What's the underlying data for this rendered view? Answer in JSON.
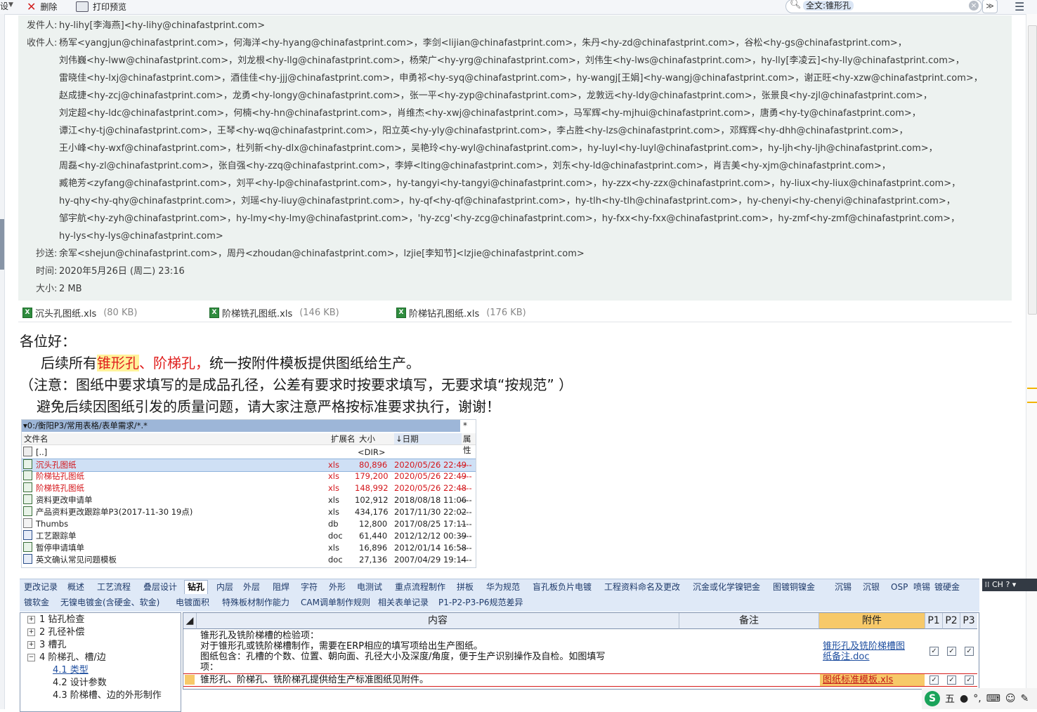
{
  "toolbar": {
    "left_fragment": "设",
    "delete_label": "删除",
    "print_label": "打印预览",
    "search_value": "全文:锥形孔"
  },
  "header": {
    "from_label": "发件人:",
    "from_value": "hy-lihy[李海燕]<hy-lihy@chinafastprint.com>",
    "to_label": "收件人:",
    "to_lines": [
      "杨军<yangjun@chinafastprint.com>，何海洋<hy-hyang@chinafastprint.com>，李剑<lijian@chinafastprint.com>，朱丹<hy-zd@chinafastprint.com>，谷松<hy-gs@chinafastprint.com>，",
      "刘伟巍<hy-lww@chinafastprint.com>，刘龙根<hy-llg@chinafastprint.com>，杨荣广<hy-yrg@chinafastprint.com>，刘伟生<hy-lws@chinafastprint.com>，hy-lly[李凌云]<hy-lly@chinafastprint.com>，",
      "雷晓佳<hy-lxj@chinafastprint.com>，酒佳佳<hy-jjj@chinafastprint.com>，申勇祁<hy-syq@chinafastprint.com>，hy-wangj[王娟]<hy-wangj@chinafastprint.com>，谢正旺<hy-xzw@chinafastprint.com>，",
      "赵成捷<hy-zcj@chinafastprint.com>，龙勇<hy-longy@chinafastprint.com>，张一平<hy-zyp@chinafastprint.com>，龙敦远<hy-ldy@chinafastprint.com>，张景良<hy-zjl@chinafastprint.com>，",
      "刘定超<hy-ldc@chinafastprint.com>，何楠<hy-hn@chinafastprint.com>，肖维杰<hy-xwj@chinafastprint.com>，马军辉<hy-mjhui@chinafastprint.com>，唐勇<hy-ty@chinafastprint.com>，",
      "谭江<hy-tj@chinafastprint.com>，王琴<hy-wq@chinafastprint.com>，阳立英<hy-yly@chinafastprint.com>，李占胜<hy-lzs@chinafastprint.com>，邓辉辉<hy-dhh@chinafastprint.com>，",
      "王小峰<hy-wxf@chinafastprint.com>，杜列新<hy-dlx@chinafastprint.com>，吴艳玲<hy-wyl@chinafastprint.com>，hy-luyl<hy-luyl@chinafastprint.com>，hy-ljh<hy-ljh@chinafastprint.com>，",
      "周磊<hy-zl@chinafastprint.com>，张自强<hy-zzq@chinafastprint.com>，李婷<lting@chinafastprint.com>，刘东<hy-ld@chinafastprint.com>，肖吉美<hy-xjm@chinafastprint.com>，",
      "臧艳芳<zyfang@chinafastprint.com>，刘平<hy-lp@chinafastprint.com>，hy-tangyi<hy-tangyi@chinafastprint.com>，hy-zzx<hy-zzx@chinafastprint.com>，hy-liux<hy-liux@chinafastprint.com>，",
      "hy-qhy<hy-qhy@chinafastprint.com>，刘瑶<hy-liuy@chinafastprint.com>，hy-qf<hy-qf@chinafastprint.com>，hy-tlh<hy-tlh@chinafastprint.com>，hy-chenyi<hy-chenyi@chinafastprint.com>，",
      "邹宇航<hy-zyh@chinafastprint.com>，hy-lmy<hy-lmy@chinafastprint.com>，'hy-zcg'<hy-zcg@chinafastprint.com>，hy-fxx<hy-fxx@chinafastprint.com>，hy-zmf<hy-zmf@chinafastprint.com>，",
      "hy-lys<hy-lys@chinafastprint.com>"
    ],
    "cc_label": "抄送:",
    "cc_value": "余军<shejun@chinafastprint.com>，周丹<zhoudan@chinafastprint.com>，lzjie[李知节]<lzjie@chinafastprint.com>",
    "time_label": "时间:",
    "time_value": "2020年5月26日 (周二) 23:16",
    "size_label": "大小:",
    "size_value": "2 MB"
  },
  "attachments": [
    {
      "name": "沉头孔图纸.xls",
      "size": "(80 KB)"
    },
    {
      "name": "阶梯铣孔图纸.xls",
      "size": "(146 KB)"
    },
    {
      "name": "阶梯钻孔图纸.xls",
      "size": "(176 KB)"
    }
  ],
  "message": {
    "greeting": "各位好：",
    "line2_pre": "后续所有",
    "line2_hl": "锥形孔",
    "line2_red": "、阶梯孔，",
    "line2_post": "统一按附件模板提供图纸给生产。",
    "line3": "（注意：图纸中要求填写的是成品孔径，公差有要求时按要求填写，无要求填“按规范” ）",
    "line4": "避免后续因图纸引发的质量问题，请大家注意严格按标准要求执行，谢谢！"
  },
  "filemanager": {
    "path": "0:/衡阳P3/常用表格/表单需求/*.*",
    "star": "*",
    "col_name": "文件名",
    "col_ext": "扩展名",
    "col_size": "大小",
    "col_date": "↓日期",
    "col_attr": "属性",
    "up_name": "[..]",
    "up_size": "<DIR>",
    "files": [
      {
        "name": "沉头孔图纸",
        "ext": "xls",
        "size": "80,896",
        "date": "2020/05/26 22:49",
        "attr": "----"
      },
      {
        "name": "阶梯钻孔图纸",
        "ext": "xls",
        "size": "179,200",
        "date": "2020/05/26 22:49",
        "attr": "----"
      },
      {
        "name": "阶梯铣孔图纸",
        "ext": "xls",
        "size": "148,992",
        "date": "2020/05/26 22:48",
        "attr": "----"
      },
      {
        "name": "资料更改申请单",
        "ext": "xls",
        "size": "102,912",
        "date": "2018/08/18 11:06",
        "attr": "----"
      },
      {
        "name": "产品资料更改跟踪单P3(2017-11-30 19点)",
        "ext": "xls",
        "size": "434,176",
        "date": "2017/11/30 22:02",
        "attr": "----"
      },
      {
        "name": "Thumbs",
        "ext": "db",
        "size": "12,800",
        "date": "2017/08/25 17:11",
        "attr": "----"
      },
      {
        "name": "工艺跟踪单",
        "ext": "doc",
        "size": "61,440",
        "date": "2012/12/12 00:39",
        "attr": "----"
      },
      {
        "name": "暂停申请填单",
        "ext": "xls",
        "size": "16,896",
        "date": "2012/01/14 16:58",
        "attr": "----"
      },
      {
        "name": "英文确认常见问题模板",
        "ext": "doc",
        "size": "27,136",
        "date": "2007/04/29 19:14",
        "attr": "----"
      }
    ]
  },
  "tabs_row1": [
    "更改记录",
    "概述",
    "工艺流程",
    "叠层设计",
    "钻孔",
    "内层",
    "外层",
    "阻焊",
    "字符",
    "外形",
    "电测试",
    "重点流程制作",
    "拼板",
    "华为规范",
    "盲孔板负片电镀",
    "工程资料命名及更改",
    "沉金或化学镍钯金",
    "图镀铜镍金",
    "沉锡",
    "沉银",
    "OSP",
    "喷锡",
    "镀硬金"
  ],
  "tabs_row2": [
    "镀软金",
    "无镍电镀金(含硬金、软金)",
    "电镀面积",
    "特殊板材制作能力",
    "CAM调单制作规则",
    "相关表单记录",
    "P1-P2-P3-P6规范差异"
  ],
  "active_tab": "钻孔",
  "ime_label": "CH",
  "tree": [
    {
      "label": "1 钻孔检查",
      "toggle": "+"
    },
    {
      "label": "2 孔径补偿",
      "toggle": "+"
    },
    {
      "label": "3 槽孔",
      "toggle": "+"
    },
    {
      "label": "4 阶梯孔、槽/边",
      "toggle": "−"
    },
    {
      "label": "4.1 类型",
      "toggle": ""
    },
    {
      "label": "4.2 设计参数",
      "toggle": ""
    },
    {
      "label": "4.3 阶梯槽、边的外形制作",
      "toggle": ""
    }
  ],
  "grid": {
    "headers": [
      "内容",
      "备注",
      "附件",
      "P1",
      "P2",
      "P3"
    ],
    "row1_lines": [
      "锥形孔及铣阶梯槽的检验项：",
      "对于锥形孔或铣阶梯槽制作，需要在ERP相应的填写项给出生产图纸。",
      "图纸包含：孔槽的个数、位置、朝向面、孔径大小及深度/角度，便于生产识别操作及自检。如图填写",
      "项："
    ],
    "row1_attach": [
      "锥形孔及铣阶梯槽图",
      "纸备注.doc"
    ],
    "row2_content": "锥形孔、阶梯孔、铣阶梯孔提供给生产标准图纸见附件。",
    "row2_attach": "图纸标准模板.xls",
    "check_mark": "✓"
  },
  "tray": {
    "s": "S",
    "wu": "五"
  }
}
